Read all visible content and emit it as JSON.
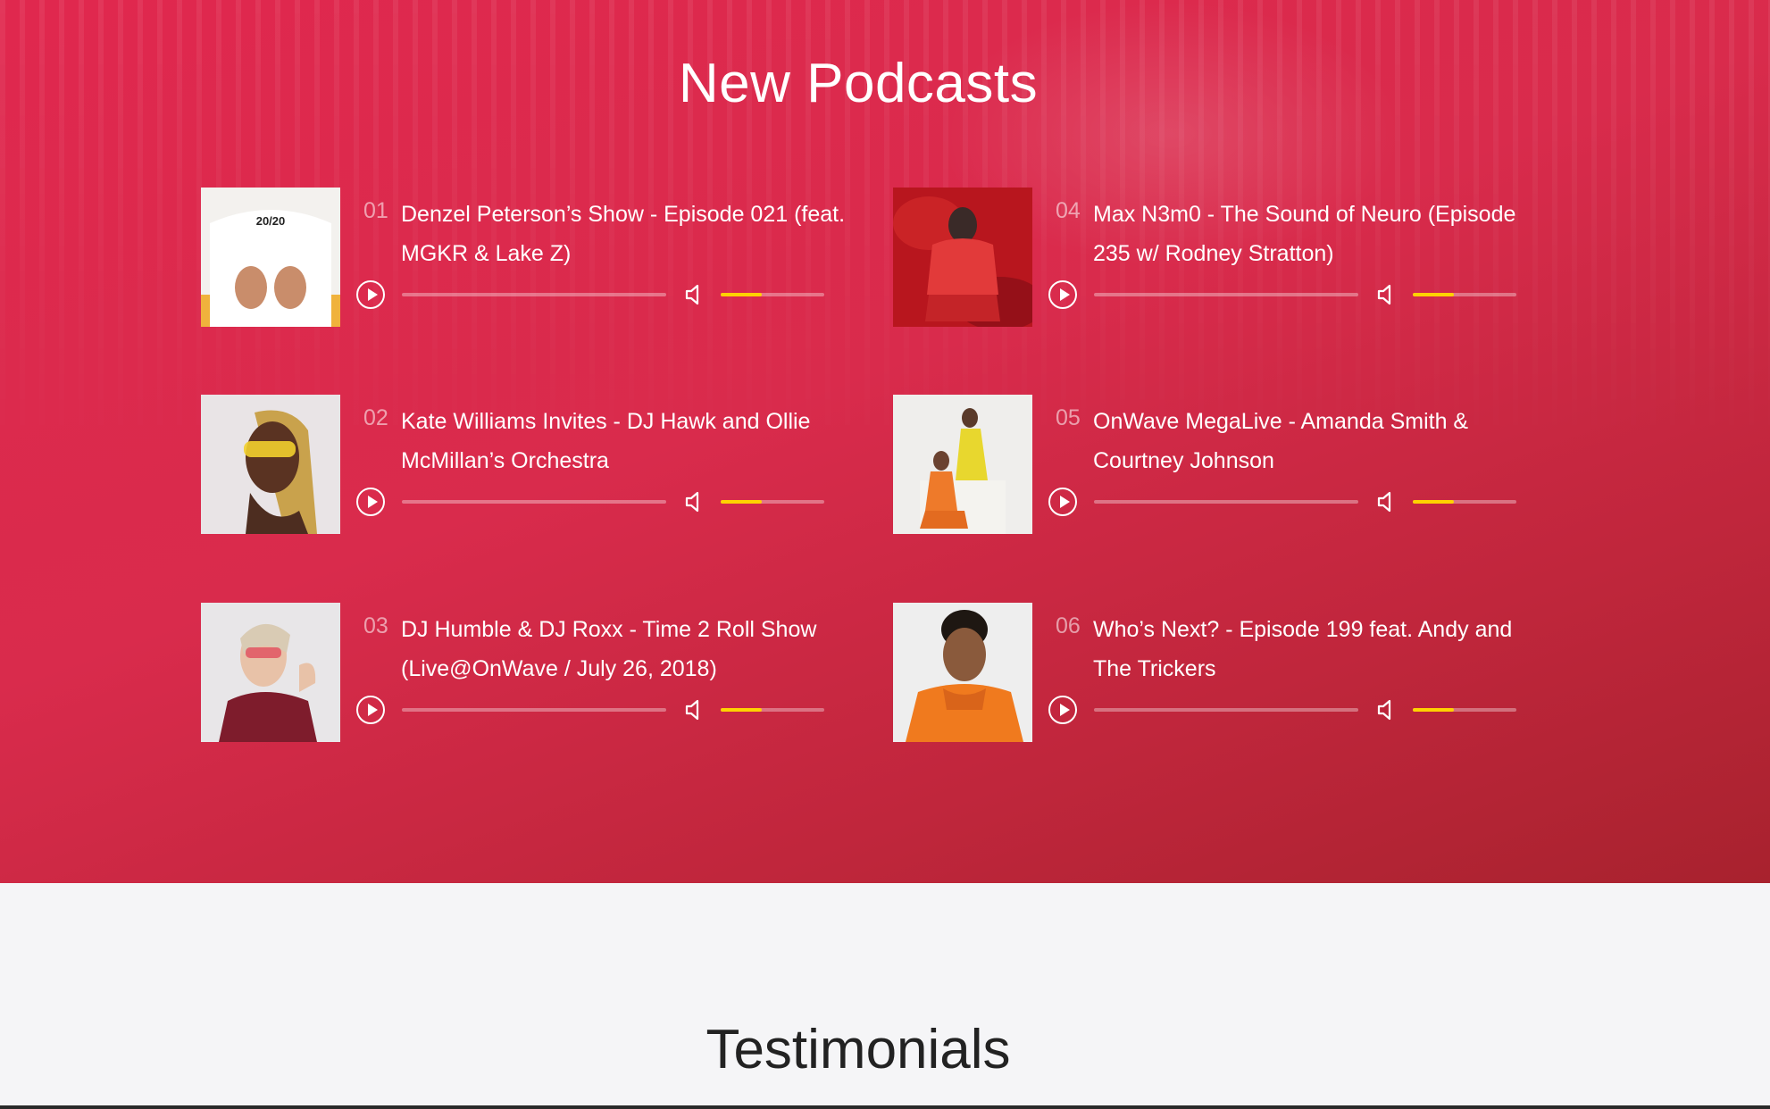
{
  "podcasts_section": {
    "title": "New Podcasts",
    "items": [
      {
        "number": "01",
        "title": "Denzel Peterson’s Show - Episode 021 (feat. MGKR & Lake Z)",
        "progress": 0,
        "volume": 0.4
      },
      {
        "number": "02",
        "title": "Kate Williams Invites - DJ Hawk and Ollie McMillan’s Orchestra",
        "progress": 0,
        "volume": 0.4
      },
      {
        "number": "03",
        "title": "DJ Humble & DJ Roxx - Time 2 Roll Show (Live@OnWave / July 26, 2018)",
        "progress": 0,
        "volume": 0.4
      },
      {
        "number": "04",
        "title": "Max N3m0 - The Sound of Neuro (Episode 235 w/ Rodney Stratton)",
        "progress": 0,
        "volume": 0.4
      },
      {
        "number": "05",
        "title": "OnWave MegaLive - Amanda Smith & Courtney Johnson",
        "progress": 0,
        "volume": 0.4
      },
      {
        "number": "06",
        "title": "Who’s Next? - Episode 199 feat. Andy and The Trickers",
        "progress": 0,
        "volume": 0.4
      }
    ]
  },
  "testimonials_section": {
    "title": "Testimonials"
  },
  "colors": {
    "accent": "#ffd200",
    "background_red": "#d92b4c"
  },
  "icons": {
    "play": "play-circle-icon",
    "volume": "speaker-icon"
  }
}
